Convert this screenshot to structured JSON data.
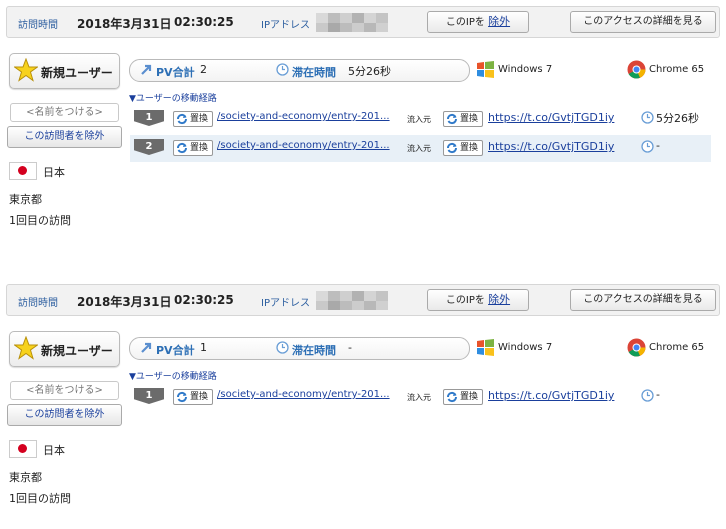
{
  "header_label": "訪問時間",
  "ip_label": "IPアドレス",
  "ip_button_prefix": "このIPを",
  "ip_button_exclude": "除外",
  "detail_button": "このアクセスの詳細を見る",
  "new_user_label": "新規ユーザー",
  "name_button": "<名前をつける>",
  "exclude_visitor_button": "この訪問者を除外",
  "pv_label": "PV合計",
  "stay_label": "滞在時間",
  "route_label": "▼ユーザーの移動経路",
  "replace_label": "置換",
  "source_label": "流入元",
  "visits": [
    {
      "date": "2018年3月31日",
      "time": "02:30:25",
      "pv_total": "2",
      "stay_time": "5分26秒",
      "os": "Windows 7",
      "browser": "Chrome 65",
      "country": "日本",
      "prefecture": "東京都",
      "visit_count": "1回目の訪問",
      "pages": [
        {
          "num": "1",
          "path": "/society-and-economy/entry-201...",
          "referrer": "https://t.co/GvtjTGD1iy",
          "duration": "5分26秒"
        },
        {
          "num": "2",
          "path": "/society-and-economy/entry-201...",
          "referrer": "https://t.co/GvtjTGD1iy",
          "duration": "-"
        }
      ]
    },
    {
      "date": "2018年3月31日",
      "time": "02:30:25",
      "pv_total": "1",
      "stay_time": "-",
      "os": "Windows 7",
      "browser": "Chrome 65",
      "country": "日本",
      "prefecture": "東京都",
      "visit_count": "1回目の訪問",
      "pages": [
        {
          "num": "1",
          "path": "/society-and-economy/entry-201...",
          "referrer": "https://t.co/GvtjTGD1iy",
          "duration": "-"
        }
      ]
    }
  ]
}
